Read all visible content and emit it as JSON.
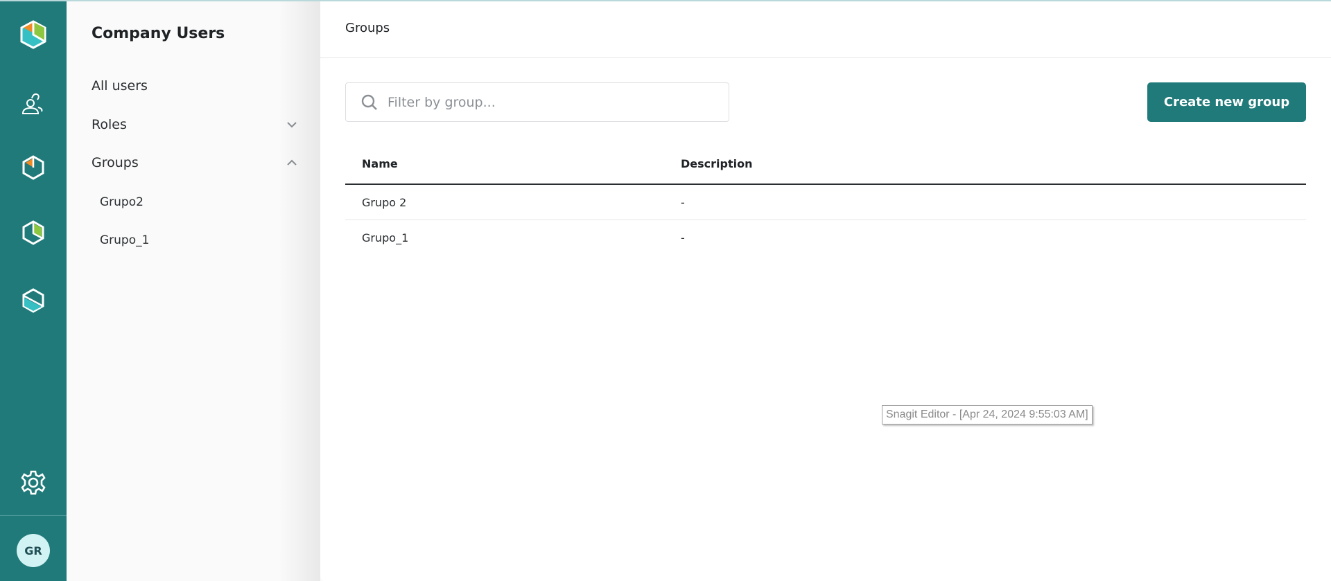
{
  "colors": {
    "brand": "#217a7a",
    "orange": "#f08a24",
    "green": "#8dc63f",
    "cyan": "#36c0c4",
    "avatar_bg": "#d2f3f3"
  },
  "rail": {
    "icons": [
      "app-logo-icon",
      "users-icon",
      "product-orange-icon",
      "product-green-icon",
      "product-cyan-icon",
      "gear-icon"
    ],
    "avatar_initials": "GR"
  },
  "subnav": {
    "title": "Company Users",
    "items": [
      {
        "label": "All users"
      },
      {
        "label": "Roles",
        "icon": "chevron-down-icon"
      },
      {
        "label": "Groups",
        "icon": "chevron-up-icon"
      }
    ],
    "groups": [
      "Grupo2",
      "Grupo_1"
    ]
  },
  "main": {
    "title": "Groups",
    "search_placeholder": "Filter by group...",
    "create_label": "Create new group",
    "table": {
      "columns": [
        "Name",
        "Description"
      ],
      "rows": [
        {
          "name": "Grupo 2",
          "description": "-"
        },
        {
          "name": "Grupo_1",
          "description": "-"
        }
      ]
    }
  },
  "tooltip": "Snagit Editor - [Apr 24, 2024 9:55:03 AM]"
}
